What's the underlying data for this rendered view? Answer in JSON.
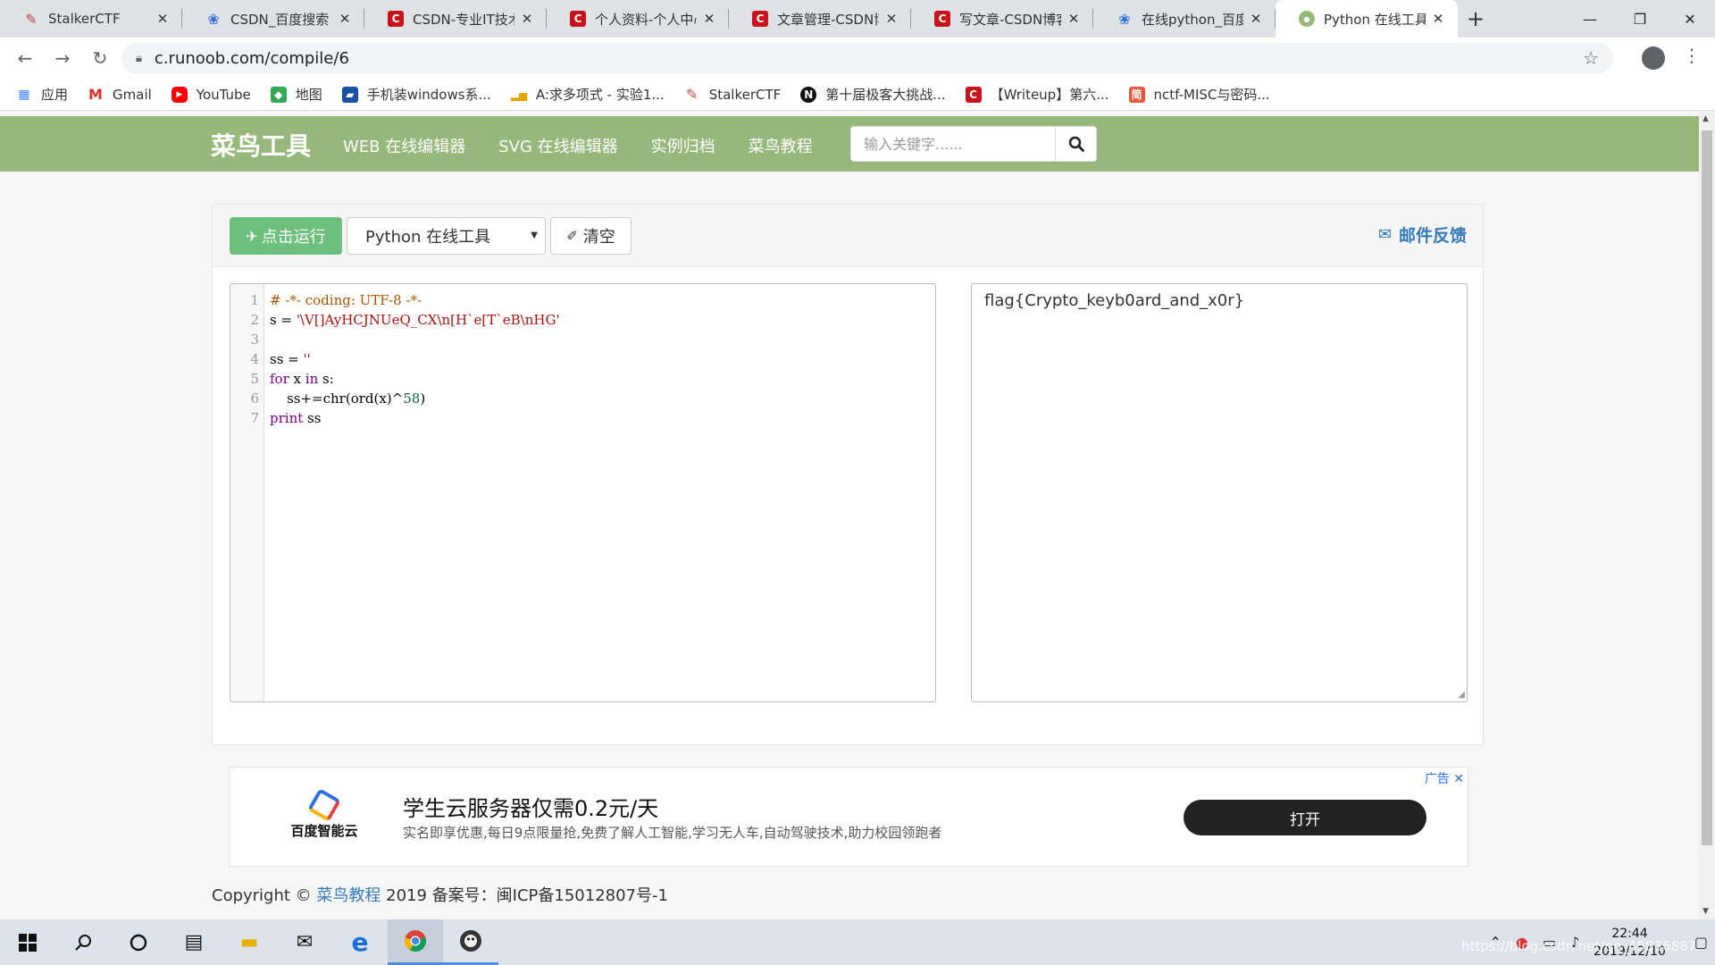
{
  "browser": {
    "tabs": [
      {
        "title": "StalkerCTF",
        "icon": "stalker-icon"
      },
      {
        "title": "CSDN_百度搜索",
        "icon": "baidu-paw-icon"
      },
      {
        "title": "CSDN-专业IT技术",
        "icon": "csdn-icon"
      },
      {
        "title": "个人资料-个人中心",
        "icon": "csdn-icon"
      },
      {
        "title": "文章管理-CSDN博",
        "icon": "csdn-icon"
      },
      {
        "title": "写文章-CSDN博客",
        "icon": "csdn-icon"
      },
      {
        "title": "在线python_百度",
        "icon": "baidu-paw-icon"
      },
      {
        "title": "Python 在线工具",
        "icon": "runoob-icon"
      }
    ],
    "url": "c.runoob.com/compile/6",
    "bookmarks": [
      {
        "label": "应用",
        "icon": "apps-grid-icon"
      },
      {
        "label": "Gmail",
        "icon": "gmail-icon"
      },
      {
        "label": "YouTube",
        "icon": "youtube-icon"
      },
      {
        "label": "地图",
        "icon": "maps-icon"
      },
      {
        "label": "手机装windows系...",
        "icon": "windows-book-icon"
      },
      {
        "label": "A:求多项式 - 实验1...",
        "icon": "histogram-icon"
      },
      {
        "label": "StalkerCTF",
        "icon": "stalker-icon"
      },
      {
        "label": "第十届极客大挑战...",
        "icon": "n-logo-icon"
      },
      {
        "label": "【Writeup】第六...",
        "icon": "csdn-icon"
      },
      {
        "label": "nctf-MISC与密码...",
        "icon": "jianshu-icon"
      }
    ]
  },
  "site": {
    "brand": "菜鸟工具",
    "nav": [
      "WEB 在线编辑器",
      "SVG 在线编辑器",
      "实例归档",
      "菜鸟教程"
    ],
    "search_placeholder": "输入关键字......"
  },
  "compiler": {
    "run_label": "点击运行",
    "language": "Python 在线工具",
    "clear_label": "清空",
    "feedback_label": "邮件反馈",
    "code_lines": [
      "# -*- coding: UTF-8 -*-",
      "s = '\\V[]AyHCJNUeQ_CX\\n[H`e[T`eB\\nHG'",
      "",
      "ss = ''",
      "for x in s:",
      "    ss+=chr(ord(x)^58)",
      "print ss"
    ],
    "output": "flag{Crypto_keyb0ard_and_x0r}"
  },
  "ad": {
    "tag": "广告",
    "brand": "百度智能云",
    "headline": "学生云服务器仅需0.2元/天",
    "description": "实名即享优惠,每日9点限量抢,免费了解人工智能,学习无人车,自动驾驶技术,助力校园领跑者",
    "button": "打开"
  },
  "footer": {
    "prefix": "Copyright © ",
    "link": "菜鸟教程",
    "suffix": " 2019 备案号：闽ICP备15012807号-1"
  },
  "taskbar": {
    "time": "22:44",
    "date": "2019/12/10",
    "watermark": "https://blog.csdn.net/qq_45836887"
  }
}
